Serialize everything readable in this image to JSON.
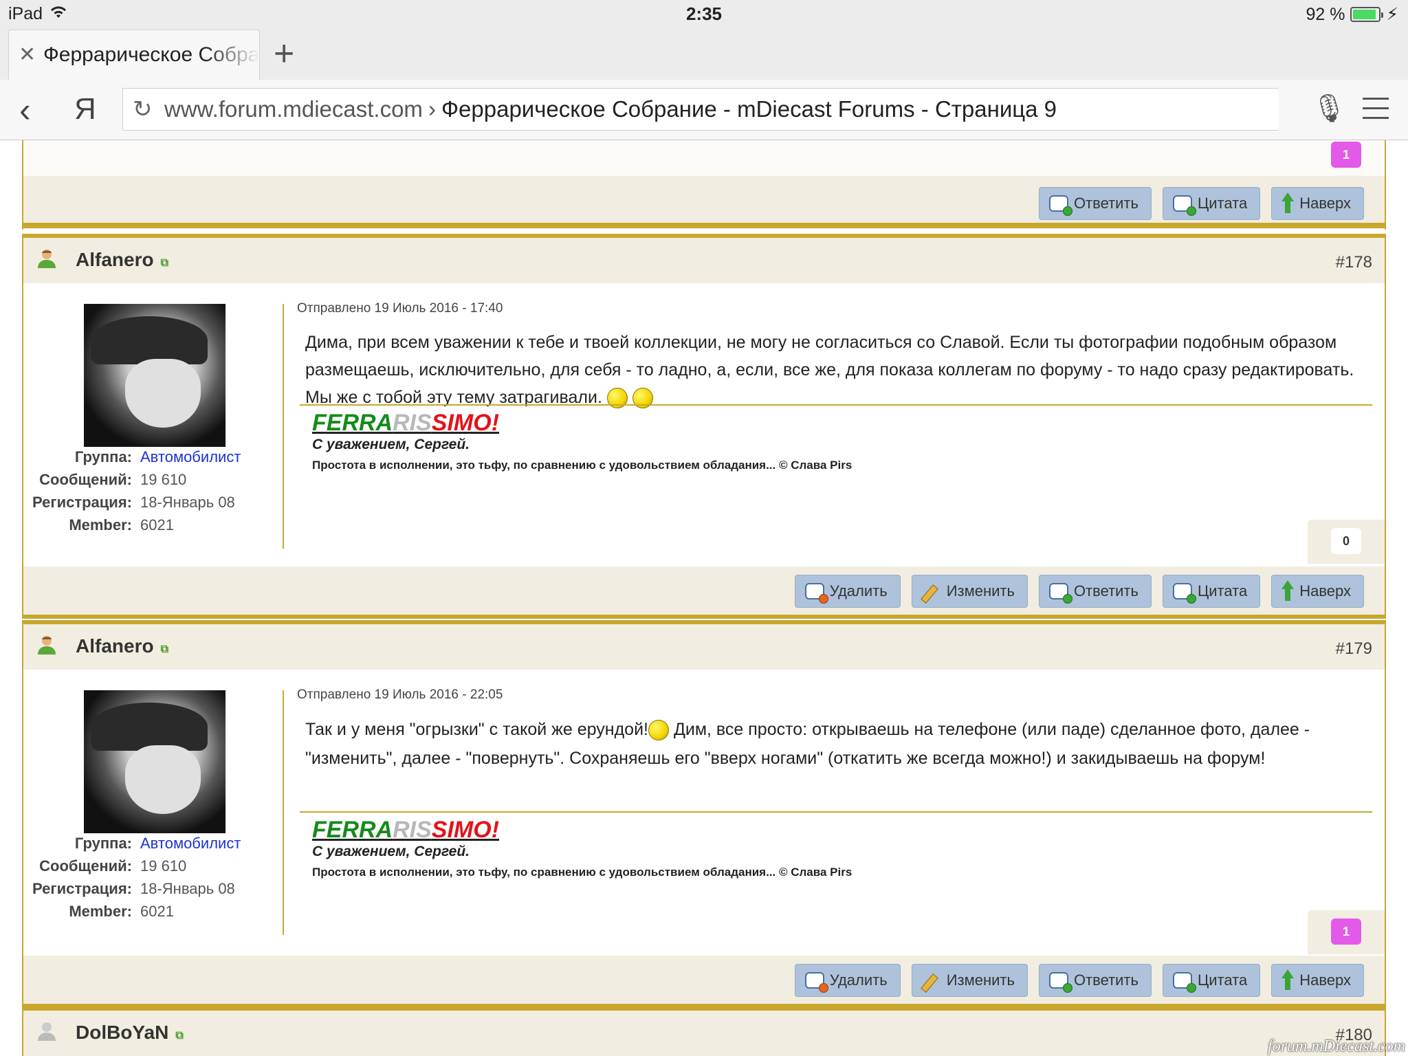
{
  "status": {
    "device": "iPad",
    "time": "2:35",
    "battery": "92 %"
  },
  "tab": {
    "title": "Феррарическое Собрание"
  },
  "address": {
    "domain": "www.forum.mdiecast.com",
    "title": "Феррарическое Собрание - mDiecast Forums - Страница 9"
  },
  "top_fragment": {
    "rep": "1",
    "buttons": [
      "Ответить",
      "Цитата",
      "Наверх"
    ]
  },
  "labels": {
    "group": "Группа:",
    "messages": "Сообщений:",
    "registration": "Регистрация:",
    "member": "Member:"
  },
  "posts": [
    {
      "user": "Alfanero",
      "number": "#178",
      "date": "Отправлено 19 Июль 2016 - 17:40",
      "text": "Дима, при всем уважении к тебе и твоей коллекции, не могу не согласиться со Славой. Если ты фотографии подобным образом размещаешь, исключительно, для себя - то ладно, а, если, все же, для показа коллегам по форуму - то надо сразу редактировать. Мы же с тобой эту тему затрагивали.",
      "group": "Автомобилист",
      "messages": "19 610",
      "registration": "18-Январь 08",
      "member": "6021",
      "rep": "0",
      "sig": {
        "brand_a": "FERRA",
        "brand_b": "RIS",
        "brand_c": "SIMO!",
        "regards": "С уважением, Сергей.",
        "quote": "Простота в исполнении, это тьфу, по сравнению с удовольствием обладания... © Слава Pirs"
      },
      "buttons": [
        "Удалить",
        "Изменить",
        "Ответить",
        "Цитата",
        "Наверх"
      ]
    },
    {
      "user": "Alfanero",
      "number": "#179",
      "date": "Отправлено 19 Июль 2016 - 22:05",
      "text_a": "Так и у меня \"огрызки\" с такой же ерундой!",
      "text_b": " Дим, все просто: открываешь на телефоне (или паде) сделанное фото, далее - \"изменить\", далее - \"повернуть\". Сохраняешь его \"вверх ногами\" (откатить же всегда можно!) и закидываешь на форум!",
      "group": "Автомобилист",
      "messages": "19 610",
      "registration": "18-Январь 08",
      "member": "6021",
      "rep": "1",
      "sig": {
        "brand_a": "FERRA",
        "brand_b": "RIS",
        "brand_c": "SIMO!",
        "regards": "С уважением, Сергей.",
        "quote": "Простота в исполнении, это тьфу, по сравнению с удовольствием обладания... © Слава Pirs"
      },
      "buttons": [
        "Удалить",
        "Изменить",
        "Ответить",
        "Цитата",
        "Наверх"
      ]
    },
    {
      "user": "DolBoYaN",
      "number": "#180"
    }
  ],
  "watermark": "forum.mDiecast.com",
  "colors": {
    "gold": "#c9a72d",
    "panel": "#f1ede0",
    "button": "#aec3db",
    "rep_positive": "#e35ae8",
    "link": "#1b32d6"
  }
}
